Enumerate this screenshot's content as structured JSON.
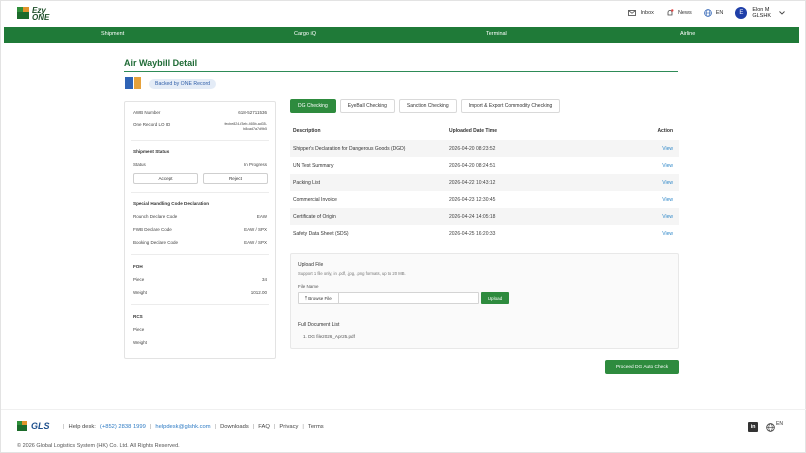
{
  "brand": {
    "line1": "Ezy",
    "line2": "ONE"
  },
  "topbar": {
    "inbox": "Inbox",
    "news": "News",
    "lang": "EN",
    "avatar_letter": "E",
    "user_name": "Elon M",
    "user_org": "GLSHK"
  },
  "nav": [
    "Shipment",
    "Cargo iQ",
    "Terminal",
    "Airline"
  ],
  "page": {
    "title": "Air Waybill Detail",
    "badge": "Backed by ONE Record"
  },
  "left": {
    "awb_label": "AWB Number",
    "awb_value": "618-52711536",
    "oneid_label": "One Record LO ID",
    "oneid_value": "fecbe824-f3eb-465b-ad35-b8cad7a7d9b5",
    "shipment_status_title": "Shipment Status",
    "status_label": "Status",
    "status_value": "In Progress",
    "accept": "Accept",
    "reject": "Reject",
    "shc_title": "Special Handling Code Declaration",
    "rows": [
      {
        "label": "Rounch Declare Code",
        "value": "EAW"
      },
      {
        "label": "FWB Declare Code",
        "value": "EAW / SPX"
      },
      {
        "label": "Booking Declare Code",
        "value": "EAW / SPX"
      }
    ],
    "foh_title": "FOH",
    "foh_piece_label": "Piece",
    "foh_piece_value": "34",
    "foh_weight_label": "Weight",
    "foh_weight_value": "1012.00",
    "rcs_title": "RCS",
    "rcs_piece_label": "Piece",
    "rcs_weight_label": "Weight"
  },
  "tabs": [
    "DG Checking",
    "EyeBall Checking",
    "Sanction Checking",
    "Import & Export Commodity Checking"
  ],
  "table": {
    "headers": [
      "Description",
      "Uploaded Date Time",
      "Action"
    ],
    "rows": [
      {
        "desc": "Shipper's Declaration for Dangerous Goods (DGD)",
        "date": "2026-04-20 08:23:52",
        "action": "View"
      },
      {
        "desc": "UN Test Summary",
        "date": "2026-04-20 08:24:51",
        "action": "View"
      },
      {
        "desc": "Packing List",
        "date": "2026-04-22 10:43:12",
        "action": "View"
      },
      {
        "desc": "Commercial Invoice",
        "date": "2026-04-23 12:30:45",
        "action": "View"
      },
      {
        "desc": "Certificate of Origin",
        "date": "2026-04-24 14:05:18",
        "action": "View"
      },
      {
        "desc": "Safety Data Sheet (SDS)",
        "date": "2026-04-25 16:20:33",
        "action": "View"
      }
    ]
  },
  "upload": {
    "title": "Upload File",
    "support": "Support 1 file only, in .pdf, .jpg, .png formats, up to 20 MB.",
    "file_name_label": "File Name",
    "browse": "⤒ Browse File",
    "upload_btn": "Upload",
    "full_doc_title": "Full Document List",
    "doc_item": "1. DG file2026_Apr25.pdf"
  },
  "proceed": "Proceed DG Auto Check",
  "footer": {
    "gls": "GLS",
    "helpdesk": "Help desk:",
    "phone": "(+852) 2838 1999",
    "email": "helpdesk@glshk.com",
    "downloads": "Downloads",
    "faq": "FAQ",
    "privacy": "Privacy",
    "terms": "Terms",
    "copyright": "© 2026 Global Logistics System (HK) Co. Ltd. All Rights Reserved.",
    "linkedin": "in",
    "lang": "EN"
  },
  "colors": {
    "primary_green": "#1f7a38",
    "button_green": "#2e8b3e",
    "link_blue": "#2e87c8"
  }
}
